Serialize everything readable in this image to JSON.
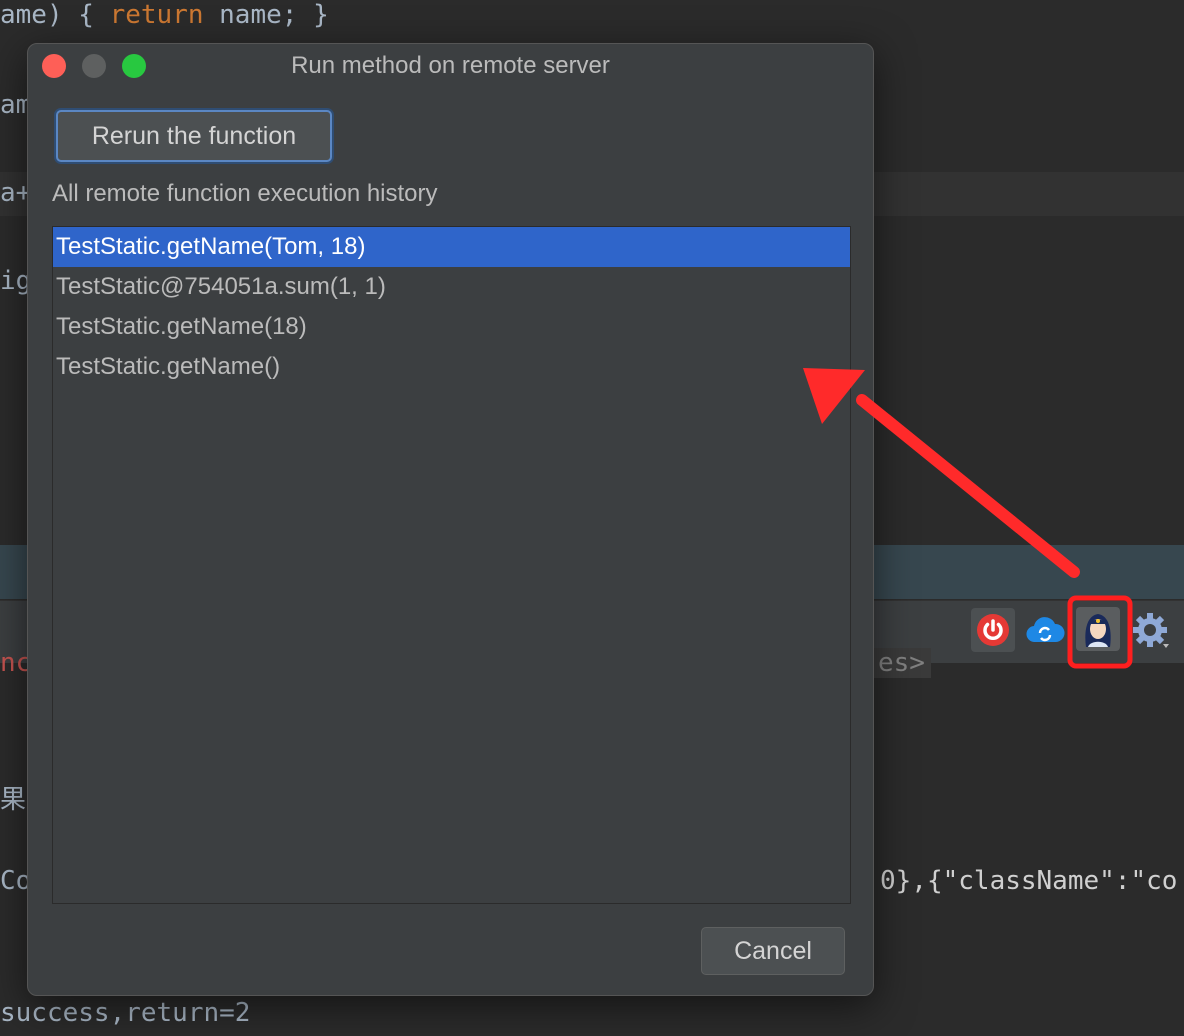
{
  "editor": {
    "line1_a": "ame) { ",
    "line1_kw": "return",
    "line1_b": " name;",
    "line1_c": " }",
    "line2": "am",
    "line3": "a+",
    "line4": "ig",
    "line5": "nct",
    "line5_right": "es>",
    "line6": "果",
    "line7_left": "Co",
    "line7_right": "0},{\"className\":\"co",
    "line8": "success,return=2"
  },
  "dialog": {
    "title": "Run method on remote server",
    "rerun_label": "Rerun the function",
    "history_label": "All remote function execution history",
    "history": [
      "TestStatic.getName(Tom, 18)",
      "TestStatic@754051a.sum(1, 1)",
      "TestStatic.getName(18)",
      "TestStatic.getName()"
    ],
    "selected_index": 0,
    "cancel_label": "Cancel"
  },
  "toolbar": {
    "icons": [
      "power-icon",
      "cloud-sync-icon",
      "avatar-icon",
      "settings-gear-icon"
    ]
  },
  "colors": {
    "selection": "#2f65ca",
    "annotation": "#ff2a2a",
    "close": "#fe5f57",
    "zoom": "#28c840"
  }
}
